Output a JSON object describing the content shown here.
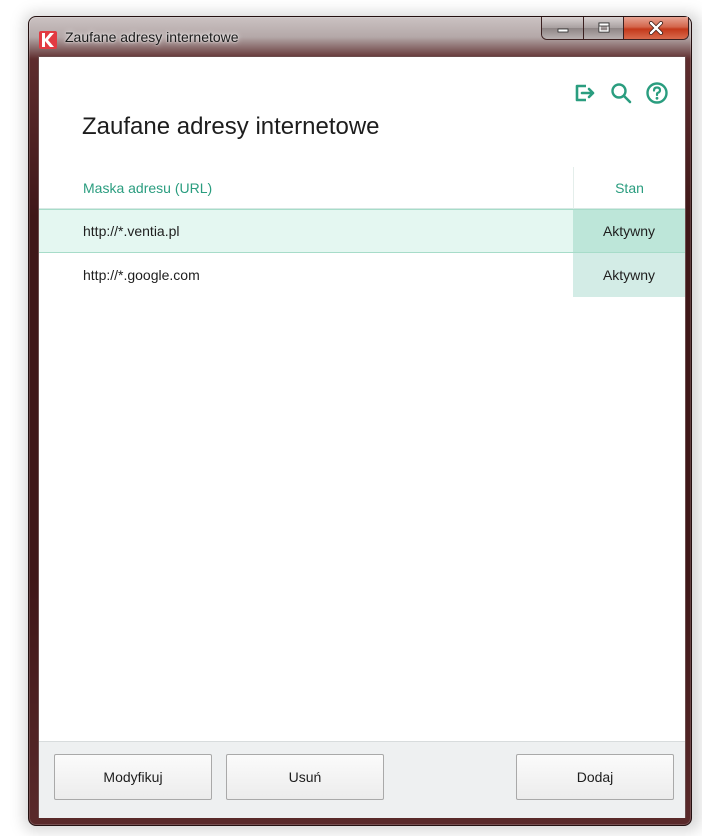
{
  "window": {
    "title": "Zaufane adresy internetowe",
    "accent_color": "#2a9d7f",
    "controls": [
      "minimize-icon",
      "maximize-icon",
      "close-icon"
    ]
  },
  "toolbar": {
    "icons": [
      "export-icon",
      "search-icon",
      "help-icon"
    ]
  },
  "page": {
    "title": "Zaufane adresy internetowe"
  },
  "table": {
    "columns": [
      "Maska adresu (URL)",
      "Stan"
    ],
    "rows": [
      {
        "url": "http://*.ventia.pl",
        "state": "Aktywny",
        "selected": true
      },
      {
        "url": "http://*.google.com",
        "state": "Aktywny",
        "selected": false
      }
    ]
  },
  "buttons": {
    "modify": "Modyfikuj",
    "delete": "Usuń",
    "add": "Dodaj"
  }
}
